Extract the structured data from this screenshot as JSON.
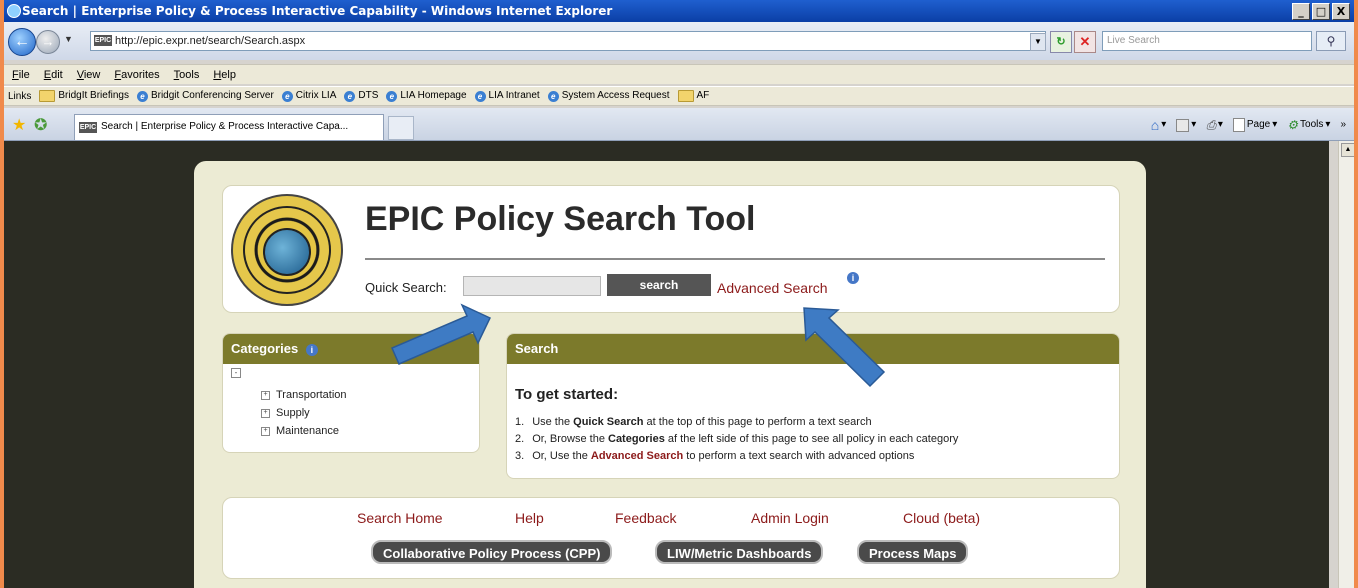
{
  "window": {
    "title": "Search | Enterprise Policy & Process Interactive Capability - Windows Internet Explorer",
    "controls": [
      "_",
      "□",
      "X"
    ]
  },
  "address_bar": {
    "url": "http://epic.expr.net/search/Search.aspx",
    "live_search_placeholder": "Live Search"
  },
  "menu": [
    "File",
    "Edit",
    "View",
    "Favorites",
    "Tools",
    "Help"
  ],
  "links_bar": {
    "label": "Links",
    "items": [
      {
        "label": "BridgIt Briefings",
        "icon": "folder-icon"
      },
      {
        "label": "Bridgit Conferencing Server",
        "icon": "ie-page-icon"
      },
      {
        "label": "Citrix LIA",
        "icon": "ie-page-icon"
      },
      {
        "label": "DTS",
        "icon": "ie-page-icon"
      },
      {
        "label": "LIA Homepage",
        "icon": "ie-page-icon"
      },
      {
        "label": "LIA Intranet",
        "icon": "ie-page-icon"
      },
      {
        "label": "System Access Request",
        "icon": "ie-page-icon"
      },
      {
        "label": "AF",
        "icon": "folder-icon"
      }
    ]
  },
  "tabs": {
    "active_label": "Search | Enterprise Policy & Process Interactive Capa...",
    "favicon_text": "EPIC"
  },
  "command_bar": {
    "page_label": "Page",
    "tools_label": "Tools"
  },
  "page": {
    "title": "EPIC Policy Search Tool",
    "quick_search_label": "Quick Search:",
    "search_button": "search",
    "advanced_search_link": "Advanced Search",
    "categories": {
      "title": "Categories",
      "items": [
        "Transportation",
        "Supply",
        "Maintenance"
      ]
    },
    "search_panel": {
      "title": "Search",
      "getting_started": "To get started:",
      "steps": [
        {
          "num": "1.",
          "pre": "Use the ",
          "bold": "Quick Search",
          "post": " at the top of this page to perform a text search"
        },
        {
          "num": "2.",
          "pre": "Or, Browse the ",
          "bold": "Categories",
          "post": " af the left side of this page to see all policy in each category"
        },
        {
          "num": "3.",
          "pre": "Or, Use the ",
          "bold": "Advanced Search",
          "post": " to perform a text search with advanced options"
        }
      ]
    },
    "footer_links": [
      "Search Home",
      "Help",
      "Feedback",
      "Admin Login",
      "Cloud (beta)"
    ],
    "footer_buttons": [
      "Collaborative Policy Process (CPP)",
      "LIW/Metric Dashboards",
      "Process Maps"
    ]
  },
  "colors": {
    "accent_olive": "#7c7a2b",
    "link_red": "#8c1a1a",
    "content_bg": "#2b2c23",
    "arrow_blue": "#3e7bc4"
  }
}
